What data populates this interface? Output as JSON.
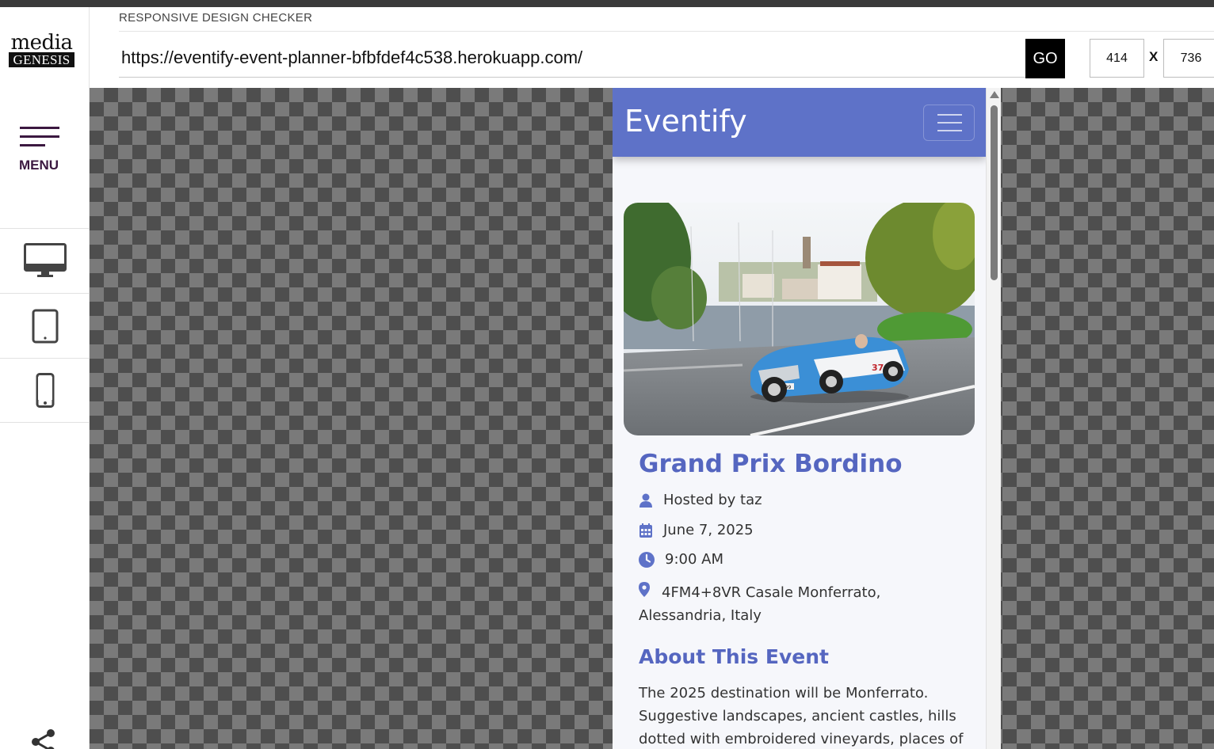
{
  "checker": {
    "title": "RESPONSIVE DESIGN CHECKER",
    "url": "https://eventify-event-planner-bfbfdef4c538.herokuapp.com/",
    "go_label": "GO",
    "width_value": "414",
    "height_value": "736",
    "x_label": "X"
  },
  "sidebar": {
    "logo_top": "media",
    "logo_bottom": "GENESIS",
    "menu_label": "MENU",
    "devices": [
      "desktop-icon",
      "tablet-icon",
      "phone-icon"
    ],
    "share_icon": "share-icon"
  },
  "site": {
    "brand": "Eventify",
    "accent_color": "#5e72c8",
    "heading_color": "#5566c0",
    "event": {
      "title": "Grand Prix Bordino",
      "host": "Hosted by taz",
      "date": "June 7, 2025",
      "time": "9:00 AM",
      "location": "4FM4+8VR Casale Monferrato, Alessandria, Italy",
      "about_title": "About This Event",
      "about_text": "The 2025 destination will be Monferrato. Suggestive landscapes, ancient castles, hills dotted with embroidered vineyards, places of"
    }
  }
}
